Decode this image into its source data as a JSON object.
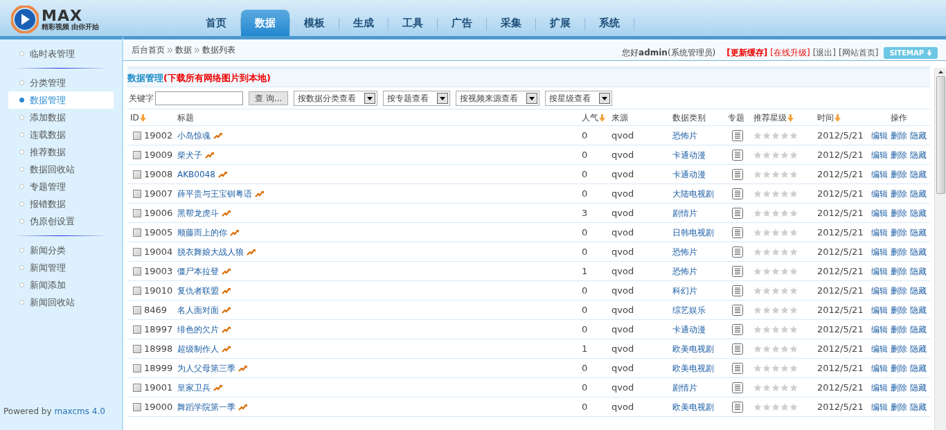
{
  "logo": {
    "name": "MAX",
    "tagline": "精彩视频 由你开始"
  },
  "nav_tabs": [
    {
      "label": "首页",
      "selected": false
    },
    {
      "label": "数据",
      "selected": true
    },
    {
      "label": "模板",
      "selected": false
    },
    {
      "label": "生成",
      "selected": false
    },
    {
      "label": "工具",
      "selected": false
    },
    {
      "label": "广告",
      "selected": false
    },
    {
      "label": "采集",
      "selected": false
    },
    {
      "label": "扩展",
      "selected": false
    },
    {
      "label": "系统",
      "selected": false
    }
  ],
  "breadcrumb": [
    "后台首页",
    "数据",
    "数据列表"
  ],
  "user_bar": {
    "greeting": "您好",
    "user": "admin",
    "role": "(系统管理员)",
    "links": [
      {
        "label": "[更新缓存]",
        "kind": "alert"
      },
      {
        "label": "[在线升级]",
        "kind": "warn"
      },
      {
        "label": "[退出]",
        "kind": "plain"
      },
      {
        "label": "[网站首页]",
        "kind": "plain"
      }
    ],
    "sitemap": "SITEMAP"
  },
  "sidebar": {
    "groups": [
      [
        {
          "label": "临时表管理",
          "selected": false
        }
      ],
      [
        {
          "label": "分类管理",
          "selected": false
        },
        {
          "label": "数据管理",
          "selected": true
        },
        {
          "label": "添加数据",
          "selected": false
        },
        {
          "label": "连载数据",
          "selected": false
        },
        {
          "label": "推荐数据",
          "selected": false
        },
        {
          "label": "数据回收站",
          "selected": false
        },
        {
          "label": "专题管理",
          "selected": false
        },
        {
          "label": "报错数据",
          "selected": false
        },
        {
          "label": "伪原创设置",
          "selected": false
        }
      ],
      [
        {
          "label": "新闻分类",
          "selected": false
        },
        {
          "label": "新闻管理",
          "selected": false
        },
        {
          "label": "新闻添加",
          "selected": false
        },
        {
          "label": "新闻回收站",
          "selected": false
        }
      ]
    ],
    "footer": "Powered by",
    "footer_link": "maxcms 4.0"
  },
  "panel": {
    "title": "数据管理",
    "title_link": "(下载所有网络图片到本地)"
  },
  "filters": {
    "keyword_label": "关键字",
    "search_button": "查 询...",
    "selects": [
      "按数据分类查看",
      "按专题查看",
      "按视频来源查看",
      "按星级查看"
    ]
  },
  "table": {
    "columns": [
      {
        "label": "ID",
        "sortable": true
      },
      {
        "label": "标题",
        "sortable": false
      },
      {
        "label": "人气",
        "sortable": true
      },
      {
        "label": "来源",
        "sortable": false
      },
      {
        "label": "数据类别",
        "sortable": false
      },
      {
        "label": "专题",
        "sortable": false
      },
      {
        "label": "推荐星级",
        "sortable": true
      },
      {
        "label": "时间",
        "sortable": true
      },
      {
        "label": "操作",
        "sortable": false
      }
    ],
    "rows": [
      {
        "id": "19002",
        "title": "小岛惊魂",
        "views": "0",
        "source": "qvod",
        "category": "恐怖片",
        "stars": 0,
        "time": "2012/5/21",
        "checked": false,
        "actions": [
          "编辑",
          "删除",
          "隐藏"
        ]
      },
      {
        "id": "19009",
        "title": "柴犬子",
        "views": "0",
        "source": "qvod",
        "category": "卡通动漫",
        "stars": 0,
        "time": "2012/5/21",
        "checked": false,
        "actions": [
          "编辑",
          "删除",
          "隐藏"
        ]
      },
      {
        "id": "19008",
        "title": "AKB0048",
        "views": "0",
        "source": "qvod",
        "category": "卡通动漫",
        "stars": 0,
        "time": "2012/5/21",
        "checked": false,
        "actions": [
          "编辑",
          "删除",
          "隐藏"
        ]
      },
      {
        "id": "19007",
        "title": "薛平贵与王宝钏粤语",
        "views": "0",
        "source": "qvod",
        "category": "大陆电视剧",
        "stars": 0,
        "time": "2012/5/21",
        "checked": false,
        "actions": [
          "编辑",
          "删除",
          "隐藏"
        ]
      },
      {
        "id": "19006",
        "title": "黑帮龙虎斗",
        "views": "3",
        "source": "qvod",
        "category": "剧情片",
        "stars": 0,
        "time": "2012/5/21",
        "checked": false,
        "actions": [
          "编辑",
          "删除",
          "隐藏"
        ]
      },
      {
        "id": "19005",
        "title": "顺藤而上的你",
        "views": "0",
        "source": "qvod",
        "category": "日韩电视剧",
        "stars": 0,
        "time": "2012/5/21",
        "checked": false,
        "actions": [
          "编辑",
          "删除",
          "隐藏"
        ]
      },
      {
        "id": "19004",
        "title": "脱衣舞娘大战人狼",
        "views": "0",
        "source": "qvod",
        "category": "恐怖片",
        "stars": 0,
        "time": "2012/5/21",
        "checked": false,
        "actions": [
          "编辑",
          "删除",
          "隐藏"
        ]
      },
      {
        "id": "19003",
        "title": "僵尸本拉登",
        "views": "1",
        "source": "qvod",
        "category": "恐怖片",
        "stars": 0,
        "time": "2012/5/21",
        "checked": false,
        "actions": [
          "编辑",
          "删除",
          "隐藏"
        ]
      },
      {
        "id": "19010",
        "title": "复仇者联盟",
        "views": "0",
        "source": "qvod",
        "category": "科幻片",
        "stars": 0,
        "time": "2012/5/21",
        "checked": false,
        "actions": [
          "编辑",
          "删除",
          "隐藏"
        ]
      },
      {
        "id": "8469",
        "title": "名人面对面",
        "views": "0",
        "source": "qvod",
        "category": "综艺娱乐",
        "stars": 0,
        "time": "2012/5/21",
        "checked": false,
        "actions": [
          "编辑",
          "删除",
          "隐藏"
        ]
      },
      {
        "id": "18997",
        "title": "绯色的欠片",
        "views": "0",
        "source": "qvod",
        "category": "卡通动漫",
        "stars": 0,
        "time": "2012/5/21",
        "checked": false,
        "actions": [
          "编辑",
          "删除",
          "隐藏"
        ]
      },
      {
        "id": "18998",
        "title": "超级制作人",
        "views": "1",
        "source": "qvod",
        "category": "欧美电视剧",
        "stars": 0,
        "time": "2012/5/21",
        "checked": false,
        "actions": [
          "编辑",
          "删除",
          "隐藏"
        ]
      },
      {
        "id": "18999",
        "title": "为人父母第三季",
        "views": "0",
        "source": "qvod",
        "category": "欧美电视剧",
        "stars": 0,
        "time": "2012/5/21",
        "checked": false,
        "actions": [
          "编辑",
          "删除",
          "隐藏"
        ]
      },
      {
        "id": "19001",
        "title": "皇家卫兵",
        "views": "0",
        "source": "qvod",
        "category": "剧情片",
        "stars": 0,
        "time": "2012/5/21",
        "checked": false,
        "actions": [
          "编辑",
          "删除",
          "隐藏"
        ]
      },
      {
        "id": "19000",
        "title": "舞蹈学院第一季",
        "views": "0",
        "source": "qvod",
        "category": "欧美电视剧",
        "stars": 0,
        "time": "2012/5/21",
        "checked": false,
        "actions": [
          "编辑",
          "删除",
          "隐藏"
        ]
      }
    ]
  }
}
